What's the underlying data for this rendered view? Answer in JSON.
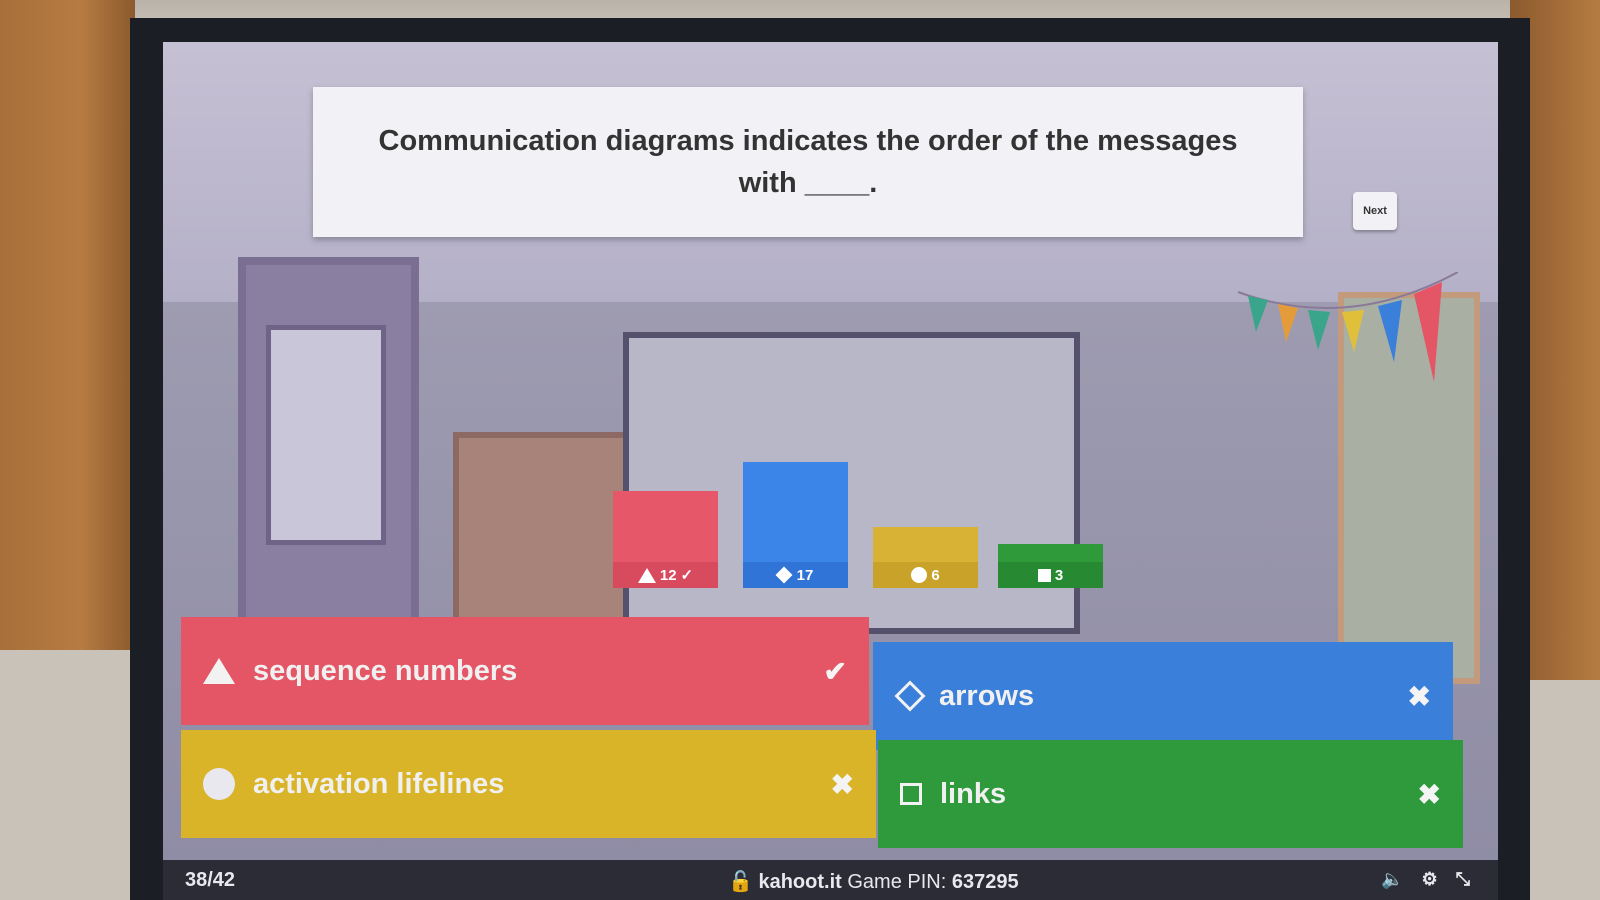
{
  "question": {
    "text": "Communication diagrams indicates the order of the messages with ____."
  },
  "next_button": {
    "label": "Next"
  },
  "results": [
    {
      "shape": "triangle",
      "count": "12",
      "correct": true,
      "color": "#e7576a",
      "level": 0.71
    },
    {
      "shape": "diamond",
      "count": "17",
      "correct": false,
      "color": "#3b84e8",
      "level": 1.0
    },
    {
      "shape": "circle",
      "count": "6",
      "correct": false,
      "color": "#d7b235",
      "level": 0.35
    },
    {
      "shape": "square",
      "count": "3",
      "correct": false,
      "color": "#2e9a3a",
      "level": 0.18
    }
  ],
  "answers": [
    {
      "shape": "triangle",
      "label": "sequence numbers",
      "correct": true,
      "mark": "✔"
    },
    {
      "shape": "diamond",
      "label": "arrows",
      "correct": false,
      "mark": "✖"
    },
    {
      "shape": "circle",
      "label": "activation lifelines",
      "correct": false,
      "mark": "✖"
    },
    {
      "shape": "square",
      "label": "links",
      "correct": false,
      "mark": "✖"
    }
  ],
  "footer": {
    "progress": "38/42",
    "site": "kahoot.it",
    "pin_label": "Game PIN:",
    "pin": "637295",
    "icons": [
      "volume-icon",
      "settings-icon",
      "fullscreen-exit-icon"
    ]
  }
}
